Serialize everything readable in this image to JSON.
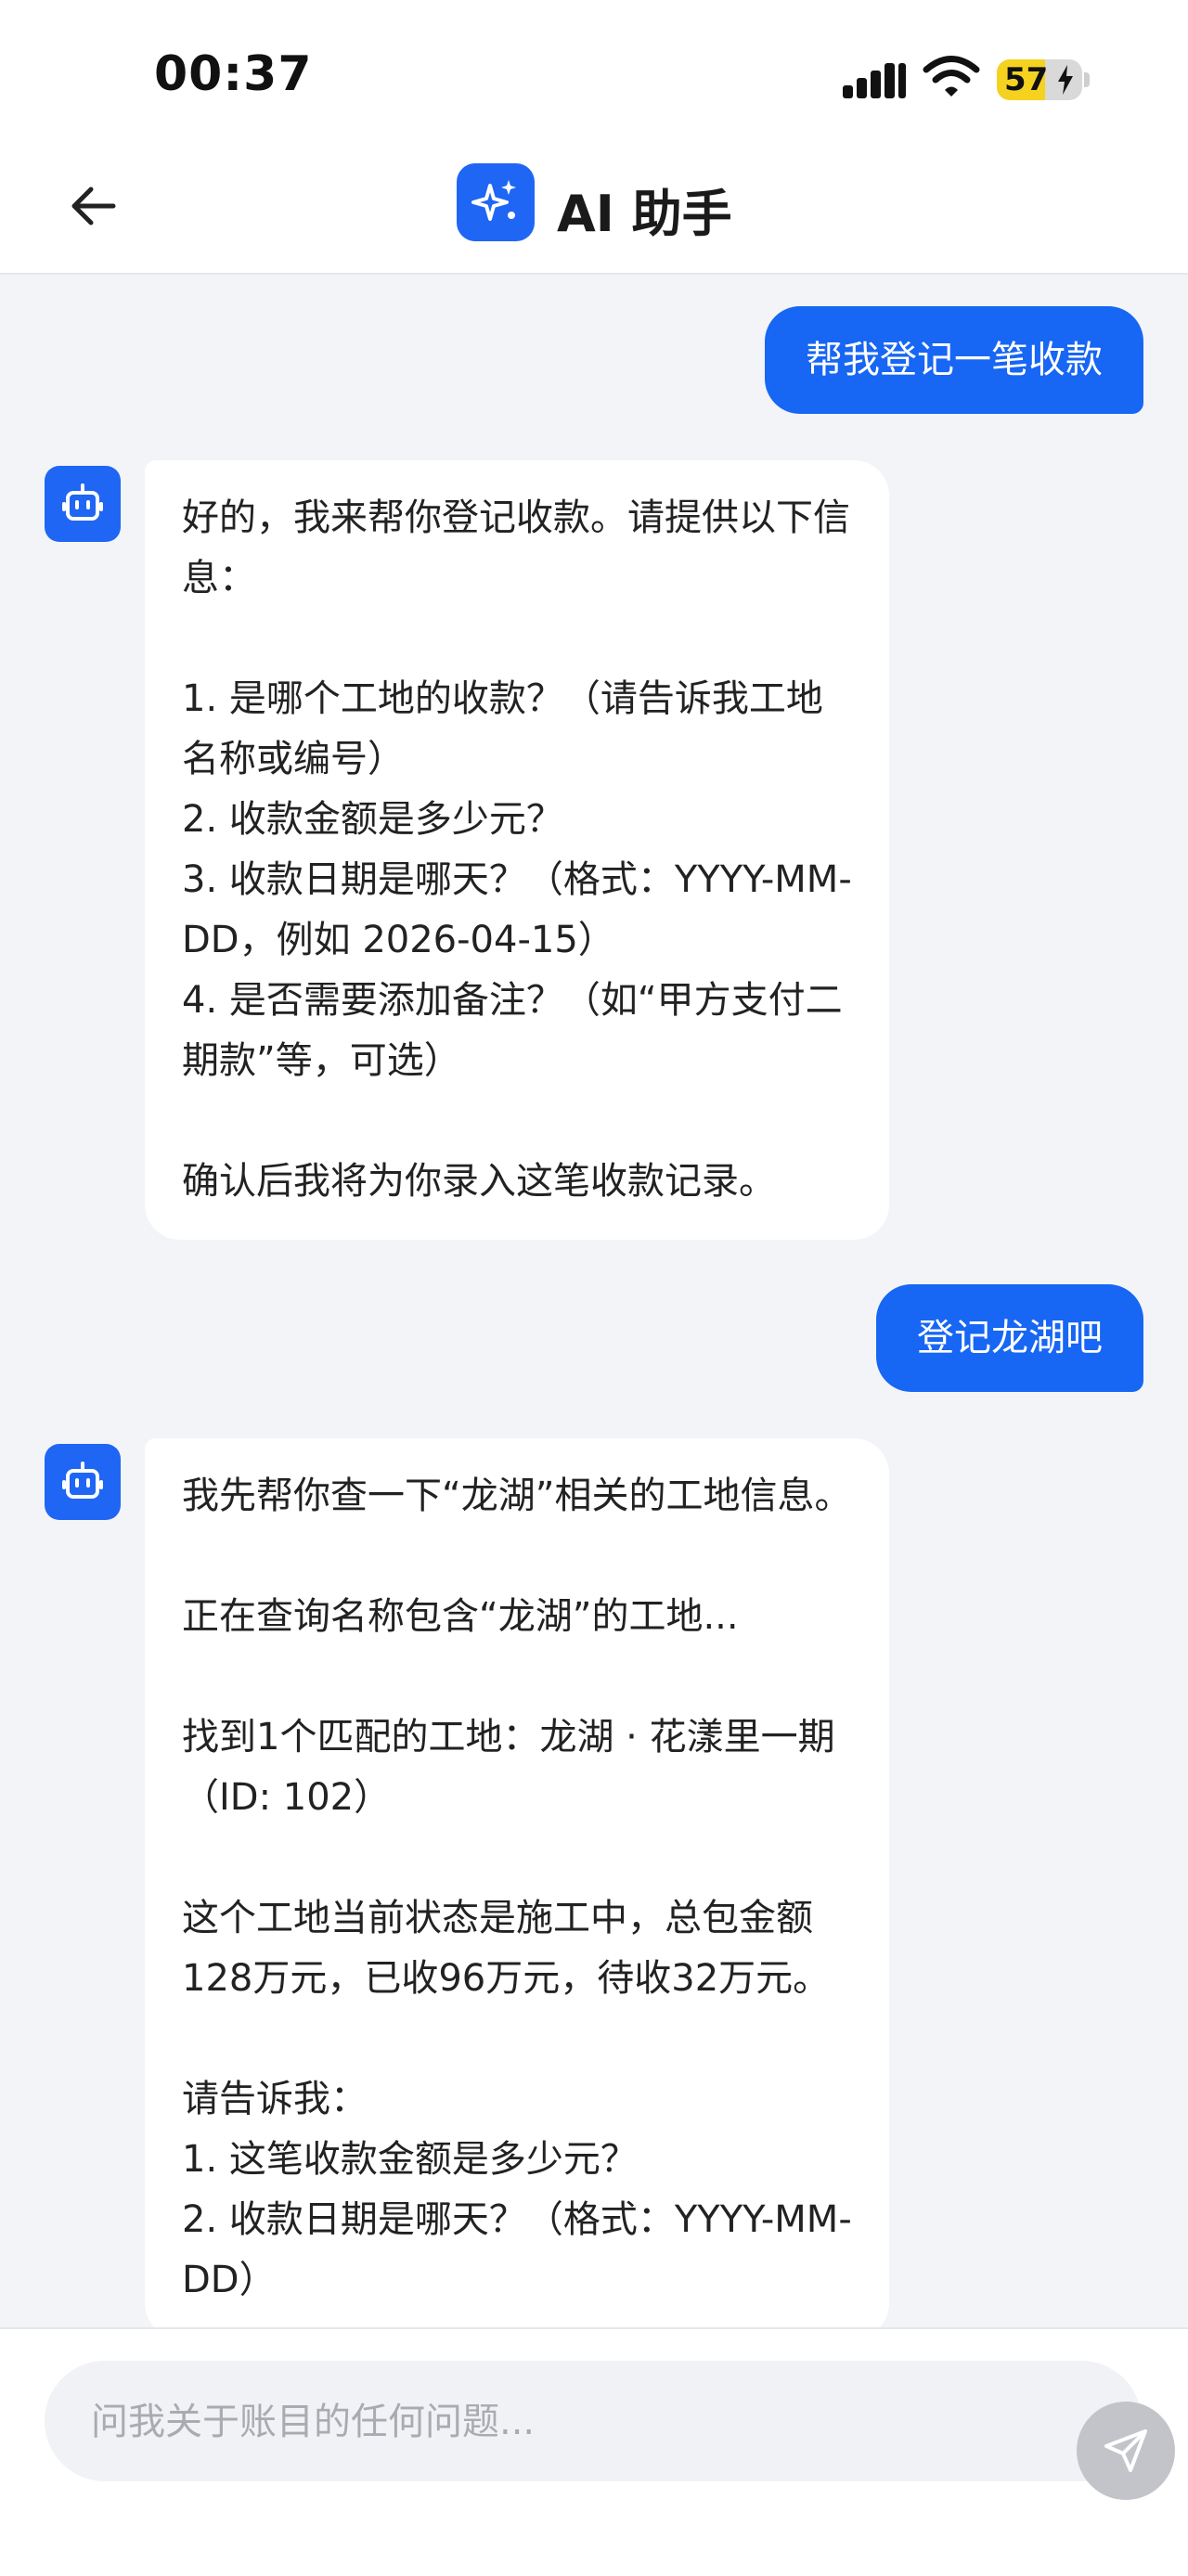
{
  "status_bar": {
    "time": "00:37",
    "battery_percent": "57",
    "battery_level": 0.57,
    "icons": [
      "cellular-signal-icon",
      "wifi-icon",
      "battery-charging-icon"
    ]
  },
  "header": {
    "back_icon": "arrow-left-icon",
    "logo_icon": "sparkle-icon",
    "title": "AI 助手"
  },
  "messages": [
    {
      "role": "user",
      "text": "帮我登记一笔收款"
    },
    {
      "role": "assistant",
      "text": "好的，我来帮你登记收款。请提供以下信息：\n\n1. 是哪个工地的收款？（请告诉我工地名称或编号）\n2. 收款金额是多少元？\n3. 收款日期是哪天？（格式：YYYY-MM-DD，例如 2026-04-15）\n4. 是否需要添加备注？（如“甲方支付二期款”等，可选）\n\n确认后我将为你录入这笔收款记录。"
    },
    {
      "role": "user",
      "text": "登记龙湖吧"
    },
    {
      "role": "assistant",
      "text": "我先帮你查一下“龙湖”相关的工地信息。\n\n正在查询名称包含“龙湖”的工地...\n\n找到1个匹配的工地：龙湖 · 花漾里一期（ID: 102）\n\n这个工地当前状态是施工中，总包金额128万元，已收96万元，待收32万元。\n\n请告诉我：\n1. 这笔收款金额是多少元？\n2. 收款日期是哪天？（格式：YYYY-MM-DD）"
    }
  ],
  "input": {
    "placeholder": "问我关于账目的任何问题...",
    "value": "",
    "send_icon": "send-icon"
  },
  "colors": {
    "accent": "#1766f4",
    "background": "#f3f4f7",
    "bubble_assistant": "#ffffff",
    "send_button_disabled": "#c2c4c9"
  }
}
